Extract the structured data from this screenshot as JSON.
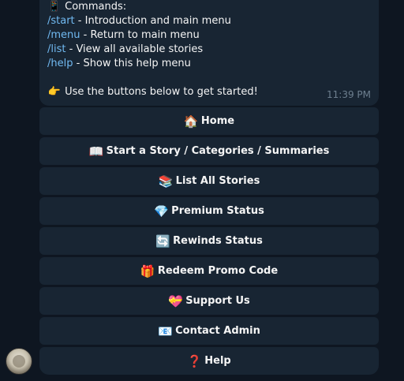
{
  "message": {
    "commands_header": "Commands:",
    "commands_header_icon": "mobile-phone-icon",
    "commands": [
      {
        "cmd": "/start",
        "desc": " - Introduction and main menu"
      },
      {
        "cmd": "/menu",
        "desc": " - Return to main menu"
      },
      {
        "cmd": "/list",
        "desc": " - View all available stories"
      },
      {
        "cmd": "/help",
        "desc": " - Show this help menu"
      }
    ],
    "footer_text": "Use the buttons below to get started!",
    "footer_icon": "pointing-hand-icon",
    "time": "11:39 PM"
  },
  "keyboard": {
    "buttons": [
      {
        "label": "Home",
        "icon": "house-icon",
        "glyph": "🏠"
      },
      {
        "label": "Start a Story / Categories / Summaries",
        "icon": "open-book-icon",
        "glyph": "📖"
      },
      {
        "label": "List All Stories",
        "icon": "books-icon",
        "glyph": "📚"
      },
      {
        "label": "Premium Status",
        "icon": "gem-icon",
        "glyph": "💎"
      },
      {
        "label": "Rewinds Status",
        "icon": "rewind-arrows-icon",
        "glyph": "🔄"
      },
      {
        "label": "Redeem Promo Code",
        "icon": "gift-icon",
        "glyph": "🎁"
      },
      {
        "label": "Support Us",
        "icon": "gift-heart-icon",
        "glyph": "💝"
      },
      {
        "label": "Contact Admin",
        "icon": "email-icon",
        "glyph": "📧"
      },
      {
        "label": "Help",
        "icon": "question-mark-icon",
        "glyph": "❓"
      }
    ]
  },
  "colors": {
    "background": "#0e1621",
    "bubble": "#182533",
    "link": "#71baf2",
    "text": "#f5f5f5",
    "time": "#6d7f8f"
  }
}
